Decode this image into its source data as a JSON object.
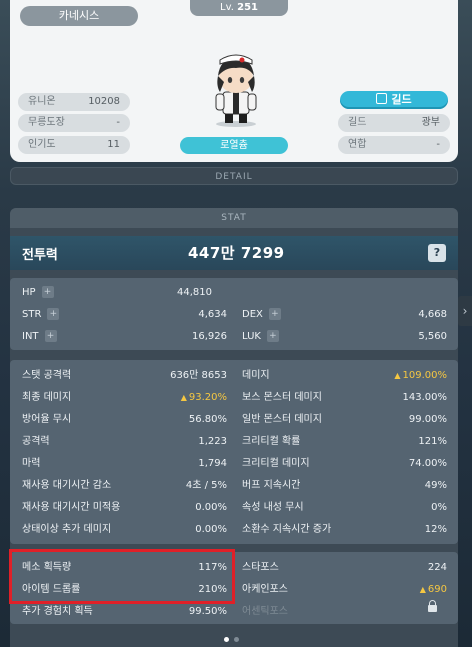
{
  "profile": {
    "world": "카네시스",
    "level_prefix": "Lv.",
    "level": "251",
    "job": "로열츔",
    "left_stats": [
      {
        "label": "유니온",
        "value": "10208"
      },
      {
        "label": "무릉도장",
        "value": "-"
      },
      {
        "label": "인기도",
        "value": "11"
      }
    ],
    "guild_button": "길드",
    "right_stats": [
      {
        "label": "길드",
        "value": "광부"
      },
      {
        "label": "연합",
        "value": "-"
      }
    ]
  },
  "detail_label": "DETAIL",
  "stat": {
    "header": "STAT",
    "combat_power_label": "전투력",
    "combat_power": "447만 7299",
    "help": "?",
    "base": {
      "hp": {
        "label": "HP",
        "value": "44,810"
      },
      "str": {
        "label": "STR",
        "value": "4,634"
      },
      "dex": {
        "label": "DEX",
        "value": "4,668"
      },
      "int": {
        "label": "INT",
        "value": "16,926"
      },
      "luk": {
        "label": "LUK",
        "value": "5,560"
      }
    },
    "detail_left": [
      {
        "label": "스탯 공격력",
        "value": "636만 8653"
      },
      {
        "label": "최종 데미지",
        "value": "93.20%",
        "up": true
      },
      {
        "label": "방어율 무시",
        "value": "56.80%"
      },
      {
        "label": "공격력",
        "value": "1,223"
      },
      {
        "label": "마력",
        "value": "1,794"
      },
      {
        "label": "재사용 대기시간 감소",
        "value": "4초 / 5%"
      },
      {
        "label": "재사용 대기시간 미적용",
        "value": "0.00%"
      },
      {
        "label": "상태이상 추가 데미지",
        "value": "0.00%"
      }
    ],
    "detail_right": [
      {
        "label": "데미지",
        "value": "109.00%",
        "up": true
      },
      {
        "label": "보스 몬스터 데미지",
        "value": "143.00%"
      },
      {
        "label": "일반 몬스터 데미지",
        "value": "99.00%"
      },
      {
        "label": "크리티컬 확률",
        "value": "121%"
      },
      {
        "label": "크리티컬 데미지",
        "value": "74.00%"
      },
      {
        "label": "버프 지속시간",
        "value": "49%"
      },
      {
        "label": "속성 내성 무시",
        "value": "0%"
      },
      {
        "label": "소환수 지속시간 증가",
        "value": "12%"
      }
    ],
    "extra_left": [
      {
        "label": "메소 획득량",
        "value": "117%"
      },
      {
        "label": "아이템 드롭률",
        "value": "210%"
      },
      {
        "label": "추가 경험치 획득",
        "value": "99.50%"
      }
    ],
    "extra_right": [
      {
        "label": "스타포스",
        "value": "224"
      },
      {
        "label": "아케인포스",
        "value": "690",
        "up": true
      },
      {
        "label": "어센틱포스",
        "value": ""
      }
    ]
  },
  "colors": {
    "highlight": "#e02028",
    "accent": "#3fc2d6",
    "gold": "#f5c742"
  }
}
